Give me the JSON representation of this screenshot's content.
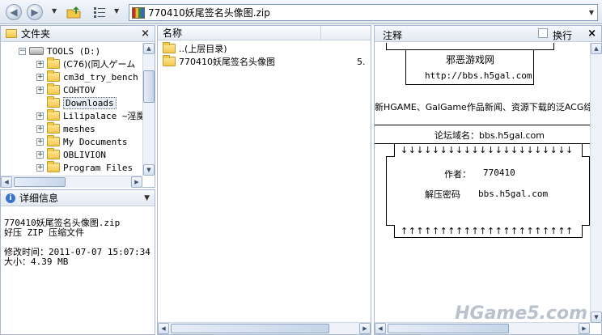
{
  "toolbar": {
    "back_icon": "back-arrow-icon",
    "forward_icon": "forward-arrow-icon",
    "view_icon": "view-list-icon",
    "address": "770410妖尾签名头像图.zip"
  },
  "folder_pane": {
    "title": "文件夹",
    "drive": "TOOLS  (D:)",
    "items": [
      {
        "label": "(C76)(同人ゲーム",
        "expandable": true
      },
      {
        "label": "cm3d_try_bench",
        "expandable": true
      },
      {
        "label": "COHTOV",
        "expandable": true
      },
      {
        "label": "Downloads",
        "expandable": false,
        "selected": true
      },
      {
        "label": "Lilipalace ~淫魔",
        "expandable": true
      },
      {
        "label": "meshes",
        "expandable": true
      },
      {
        "label": "My Documents",
        "expandable": true
      },
      {
        "label": "OBLIVION",
        "expandable": true
      },
      {
        "label": "Program Files",
        "expandable": true
      }
    ]
  },
  "details_pane": {
    "title": "详细信息",
    "filename": "770410妖尾签名头像图.zip",
    "type": "好压 ZIP 压缩文件",
    "modified": "修改时间：2011-07-07 15:07:34",
    "size": "大小：4.39 MB"
  },
  "file_list": {
    "col_name": "名称",
    "rows": [
      {
        "name": "..(上层目录)",
        "extra": ""
      },
      {
        "name": "770410妖尾签名头像图",
        "extra": "5."
      }
    ]
  },
  "comment_pane": {
    "title": "注释",
    "wrap_label": "换行",
    "site_name": "邪恶游戏网",
    "site_url": "http://bbs.h5gal.com",
    "desc": "新HGAME、GalGame作品新闻、资源下载的泛ACG综合",
    "domain": "论坛域名：bbs.h5gal.com",
    "arrows_down": "↓↓↓↓↓↓↓↓↓↓↓↓↓↓↓↓↓↓↓↓↓↓",
    "author_label": "作者：",
    "author_value": "770410",
    "pwd_label": "解压密码",
    "pwd_value": "bbs.h5gal.com",
    "arrows_up": "↑↑↑↑↑↑↑↑↑↑↑↑↑↑↑↑↑↑↑↑↑↑"
  },
  "watermark": "HGame5.com"
}
